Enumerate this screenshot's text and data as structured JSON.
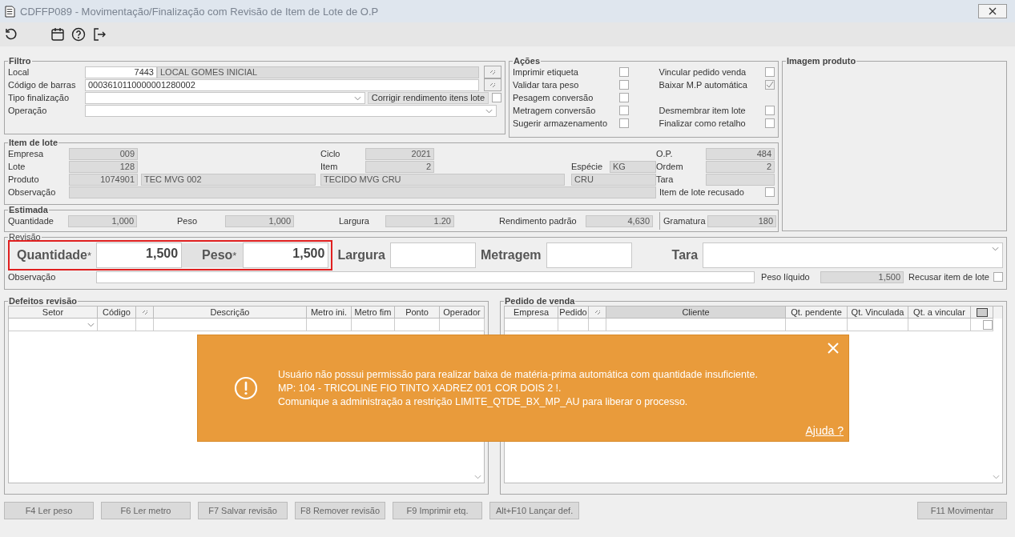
{
  "window": {
    "title": "CDFFP089 - Movimentação/Finalização com Revisão de Item de Lote de O.P"
  },
  "filtro": {
    "title": "Filtro",
    "local": {
      "label": "Local",
      "code": "7443",
      "name": "LOCAL GOMES INICIAL"
    },
    "codigo_barras": {
      "label": "Código de barras",
      "value": "0003610110000001280002"
    },
    "tipo_finalizacao": {
      "label": "Tipo finalização"
    },
    "corrigir_rendimento": {
      "label": "Corrigir rendimento itens lote",
      "checked": false
    },
    "operacao": {
      "label": "Operação"
    }
  },
  "acoes": {
    "title": "Ações",
    "left": [
      {
        "label": "Imprimir etiqueta",
        "checked": false
      },
      {
        "label": "Validar tara peso",
        "checked": false
      },
      {
        "label": "Pesagem conversão",
        "checked": false
      },
      {
        "label": "Metragem conversão",
        "checked": false
      },
      {
        "label": "Sugerir armazenamento",
        "checked": false
      }
    ],
    "right": [
      {
        "label": "Vincular pedido venda",
        "checked": false
      },
      {
        "label": "Baixar M.P automática",
        "checked": true
      },
      {
        "label": "Desmembrar item lote",
        "checked": false
      },
      {
        "label": "Finalizar como retalho",
        "checked": false
      }
    ]
  },
  "imagem_produto": {
    "title": "Imagem produto"
  },
  "item_lote": {
    "title": "Item de lote",
    "empresa": {
      "label": "Empresa",
      "value": "009"
    },
    "lote": {
      "label": "Lote",
      "value": "128"
    },
    "produto": {
      "label": "Produto",
      "code": "1074901",
      "name": "TEC MVG 002",
      "description": "TECIDO MVG CRU",
      "type": "CRU"
    },
    "observacao": {
      "label": "Observação"
    },
    "ciclo": {
      "label": "Ciclo",
      "value": "2021"
    },
    "item": {
      "label": "Item",
      "value": "2"
    },
    "especie": {
      "label": "Espécie",
      "value": "KG"
    },
    "op": {
      "label": "O.P.",
      "value": "484"
    },
    "ordem": {
      "label": "Ordem",
      "value": "2"
    },
    "tara": {
      "label": "Tara"
    },
    "recusado": {
      "label": "Item de lote recusado",
      "checked": false
    }
  },
  "estimada": {
    "title": "Estimada",
    "fields": [
      {
        "label": "Quantidade",
        "value": "1,000"
      },
      {
        "label": "Peso",
        "value": "1,000"
      },
      {
        "label": "Largura",
        "value": "1.20"
      },
      {
        "label": "Rendimento padrão",
        "value": "4,630"
      },
      {
        "label": "Gramatura",
        "value": "180"
      }
    ]
  },
  "revisao": {
    "title": "Revisão",
    "fields": [
      {
        "label": "Quantidade",
        "marker": "*",
        "value": "1,500",
        "kind": "text",
        "highlighted": true
      },
      {
        "label": "Peso",
        "marker": "*",
        "value": "1,500",
        "kind": "text",
        "highlighted": true
      },
      {
        "label": "Largura",
        "kind": "text",
        "highlighted": false
      },
      {
        "label": "Metragem",
        "kind": "text",
        "highlighted": false
      },
      {
        "label": "Tara",
        "kind": "select",
        "highlighted": false
      }
    ],
    "observacao": {
      "label": "Observação"
    },
    "peso_liquido": {
      "label": "Peso líquido",
      "value": "1,500"
    },
    "recusar": {
      "label": "Recusar item de lote",
      "checked": false
    }
  },
  "defeitos": {
    "title": "Defeitos revisão",
    "columns": [
      {
        "kind": "text",
        "label": "Setor"
      },
      {
        "kind": "text",
        "label": "Código"
      },
      {
        "kind": "icon"
      },
      {
        "kind": "text",
        "label": "Descrição"
      },
      {
        "kind": "text",
        "label": "Metro ini."
      },
      {
        "kind": "text",
        "label": "Metro fim"
      },
      {
        "kind": "text",
        "label": "Ponto"
      },
      {
        "kind": "text",
        "label": "Operador"
      }
    ]
  },
  "pedido_venda": {
    "title": "Pedido de venda",
    "columns": [
      {
        "kind": "text",
        "label": "Empresa"
      },
      {
        "kind": "text",
        "label": "Pedido"
      },
      {
        "kind": "icon"
      },
      {
        "kind": "text",
        "label": "Cliente"
      },
      {
        "kind": "text",
        "label": "Qt. pendente"
      },
      {
        "kind": "text",
        "label": "Qt. Vinculada"
      },
      {
        "kind": "text",
        "label": "Qt. a vincular"
      },
      {
        "kind": "checkbox"
      }
    ],
    "rows": [
      {
        "checked": false
      }
    ]
  },
  "buttons": [
    {
      "label": "F4 Ler peso",
      "disabled": true
    },
    {
      "label": "F6 Ler metro",
      "disabled": true
    },
    {
      "label": "F7 Salvar revisão",
      "disabled": true
    },
    {
      "label": "F8 Remover revisão",
      "disabled": true
    },
    {
      "label": "F9 Imprimir etq.",
      "disabled": true
    },
    {
      "label": "Alt+F10 Lançar def.",
      "disabled": true
    },
    {
      "label": "F11 Movimentar",
      "disabled": true
    }
  ],
  "alert": {
    "lines": [
      "Usuário não possui permissão para realizar baixa de matéria-prima automática com quantidade insuficiente.",
      "MP: 104 - TRICOLINE FIO TINTO XADREZ 001 COR DOIS 2 !.",
      "Comunique a administração a restrição LIMITE_QTDE_BX_MP_AU para liberar o processo."
    ],
    "link": "Ajuda ?"
  }
}
